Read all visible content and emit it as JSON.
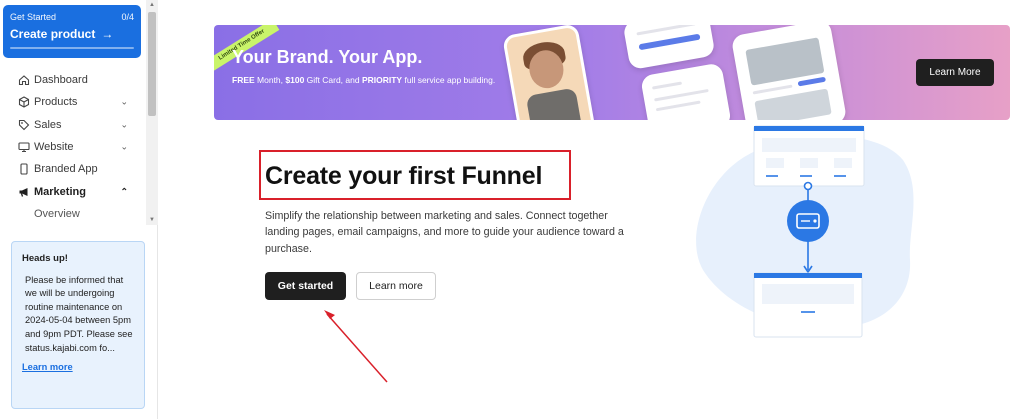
{
  "sidebar": {
    "get_started": {
      "label": "Get Started",
      "progress": "0/4",
      "progress_fraction": 0.0,
      "title": "Create product",
      "arrow": "→"
    },
    "nav": [
      {
        "label": "Dashboard",
        "icon": "home-icon"
      },
      {
        "label": "Products",
        "icon": "box-icon",
        "chevron": "⌄"
      },
      {
        "label": "Sales",
        "icon": "tag-icon",
        "chevron": "⌄"
      },
      {
        "label": "Website",
        "icon": "monitor-icon",
        "chevron": "⌄"
      },
      {
        "label": "Branded App",
        "icon": "phone-icon"
      },
      {
        "label": "Marketing",
        "icon": "megaphone-icon",
        "chevron": "⌃",
        "active": true
      },
      {
        "label": "Overview"
      }
    ],
    "notice": {
      "title": "Heads up!",
      "body": " Please be informed that we will be undergoing routine maintenance on 2024-05-04 between 5pm and 9pm PDT. Please see status.kajabi.com fo...",
      "link": "Learn more"
    }
  },
  "banner": {
    "ribbon": "Limited Time Offer",
    "title": "Your Brand. Your App.",
    "subtitle_parts": [
      "FREE",
      " Month, ",
      "$100",
      " Gift Card, and ",
      "PRIORITY",
      " full service app building."
    ],
    "button": "Learn More"
  },
  "main": {
    "headline": "Create your first Funnel",
    "description": "Simplify the relationship between marketing and sales. Connect together landing pages, email campaigns, and more to guide your audience toward a purchase.",
    "primary_button": "Get started",
    "secondary_button": "Learn more"
  },
  "colors": {
    "brand_blue": "#1a6fe0",
    "annotation_red": "#d9202a",
    "dark_button": "#1f1f1f"
  }
}
